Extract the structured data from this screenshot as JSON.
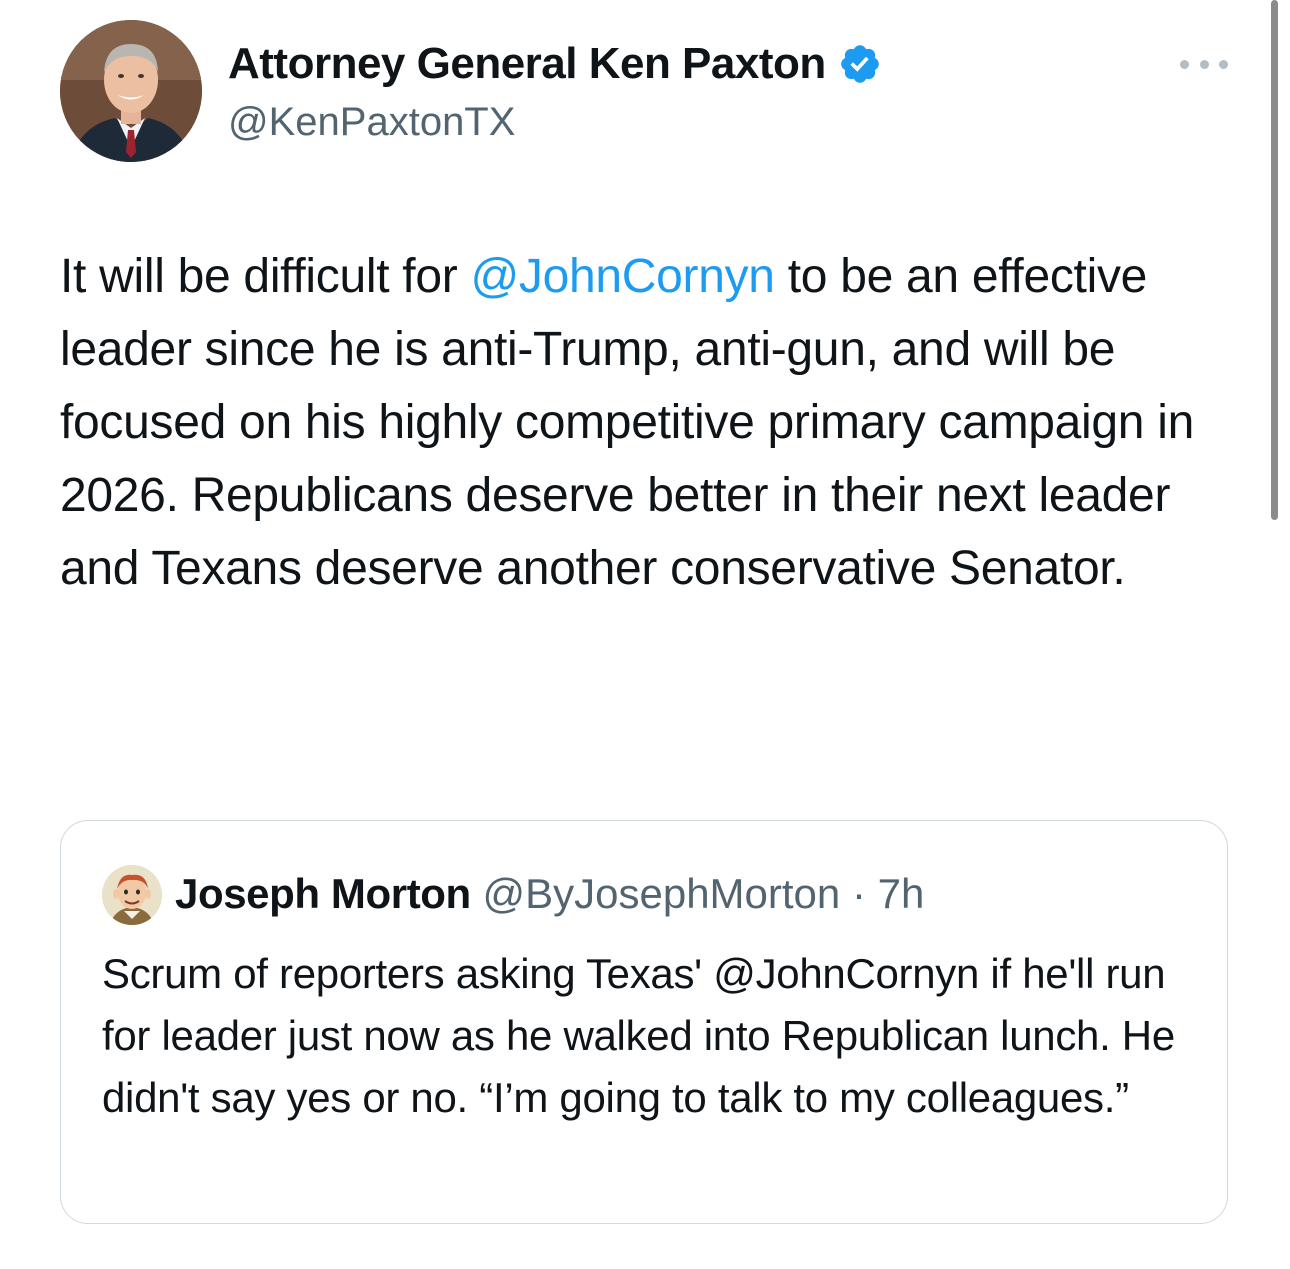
{
  "tweet": {
    "author": {
      "display_name": "Attorney General Ken Paxton",
      "handle": "@KenPaxtonTX",
      "avatar_icon": "profile-photo",
      "verified_icon": "verified-badge-icon",
      "verified_color": "#1d9bf0"
    },
    "more_icon": "more-options-icon",
    "text": {
      "part1": "It will be difficult for ",
      "mention": "@JohnCornyn",
      "part2": " to be an effective leader since he is anti-Trump, anti-gun, and will be focused on his highly competitive primary campaign in 2026. Republicans deserve better in their next leader and Texans deserve another conservative Senator."
    },
    "mention_color": "#1d9bf0"
  },
  "quoted_tweet": {
    "author": {
      "display_name": "Joseph Morton",
      "handle": "@ByJosephMorton",
      "avatar_icon": "cartoon-avatar"
    },
    "separator": "·",
    "time": "7h",
    "text": "Scrum of reporters asking Texas' @JohnCornyn if he'll run for leader just now as he walked into Republican lunch. He didn't say yes or no. “I’m going to talk to my colleagues.”"
  }
}
